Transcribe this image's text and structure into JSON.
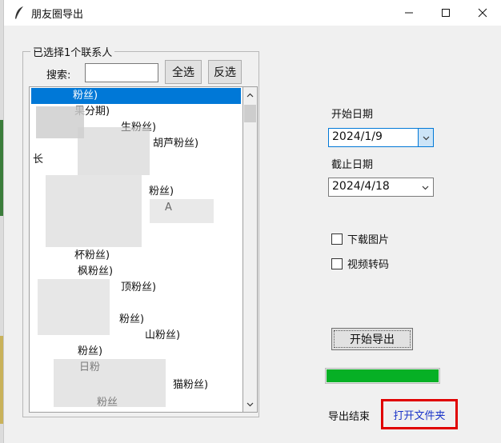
{
  "window": {
    "title": "朋友圈导出",
    "controls": [
      "minimize",
      "maximize",
      "close"
    ]
  },
  "contacts": {
    "group_label": "已选择1个联系人",
    "search_label": "搜索:",
    "search_value": "",
    "select_all_label": "全选",
    "invert_label": "反选",
    "items": [
      "粉丝)",
      "果分期)",
      "生粉丝)",
      "胡芦粉丝)",
      "长",
      "",
      "粉丝)",
      "A",
      "",
      "",
      "杯粉丝)",
      "枫粉丝)",
      "顶粉丝)",
      "",
      "粉丝)",
      "山粉丝)",
      "粉丝)",
      "日粉",
      "猫粉丝)",
      "粉丝"
    ],
    "selected_index": 0
  },
  "dates": {
    "start_label": "开始日期",
    "start_value": "2024/1/9",
    "end_label": "截止日期",
    "end_value": "2024/4/18"
  },
  "options": {
    "download_images_label": "下载图片",
    "download_images_checked": false,
    "video_transcode_label": "视频转码",
    "video_transcode_checked": false
  },
  "actions": {
    "start_export_label": "开始导出"
  },
  "progress": {
    "fraction": 1.0,
    "color": "#06b025"
  },
  "status": {
    "text": "导出结束",
    "open_folder_label": "打开文件夹",
    "highlight_color": "#e00000"
  }
}
